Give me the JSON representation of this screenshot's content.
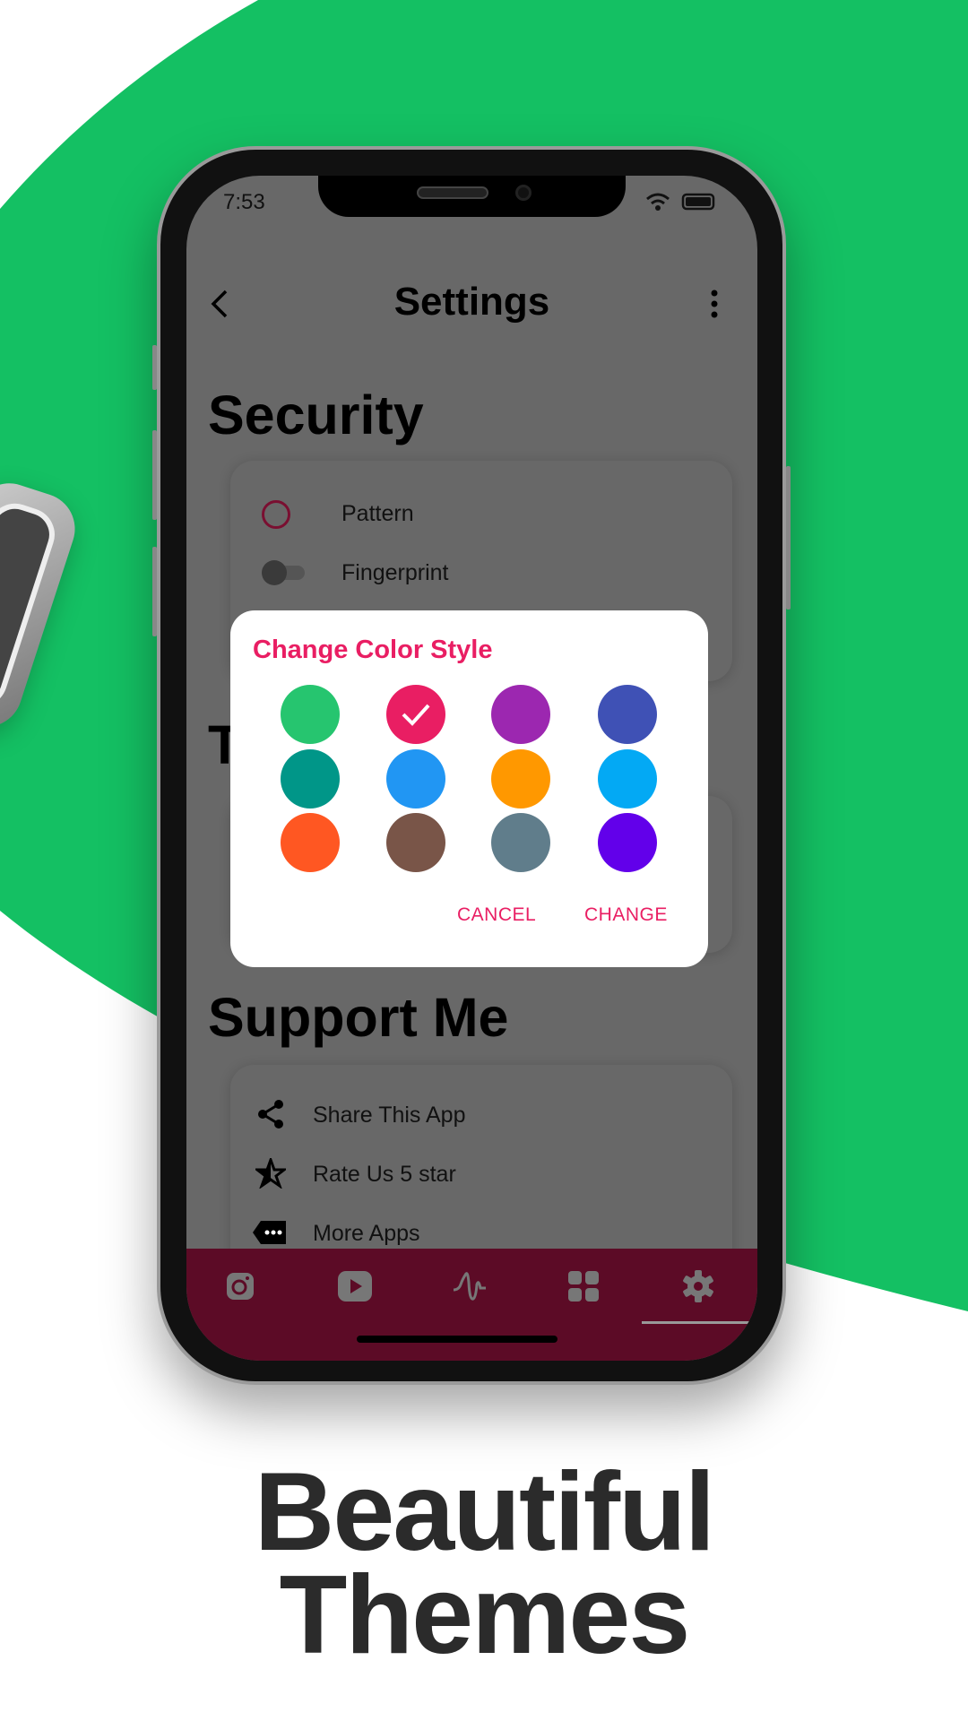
{
  "status_bar": {
    "time": "7:53"
  },
  "app_bar": {
    "title": "Settings",
    "back_icon": "chevron-left-icon",
    "menu_icon": "more-vert-icon"
  },
  "sections": {
    "security": {
      "heading": "Security",
      "items": [
        {
          "label": "Pattern",
          "control": "radio",
          "checked": false
        },
        {
          "label": "Fingerprint",
          "control": "toggle",
          "on": false
        }
      ]
    },
    "theme": {
      "heading_visible": "T"
    },
    "support": {
      "heading": "Support Me",
      "items": [
        {
          "label": "Share This App",
          "icon": "share-icon"
        },
        {
          "label": "Rate Us 5 star",
          "icon": "star-icon"
        },
        {
          "label": "More Apps",
          "icon": "more-apps-tag-icon"
        }
      ]
    }
  },
  "dialog": {
    "title": "Change Color Style",
    "selected_index": 1,
    "colors": [
      "#26c56f",
      "#e91e63",
      "#9c27b0",
      "#3f51b5",
      "#009688",
      "#2196f3",
      "#ff9800",
      "#03a9f4",
      "#ff5722",
      "#795548",
      "#607d8b",
      "#6200ea"
    ],
    "cancel_label": "CANCEL",
    "change_label": "CHANGE"
  },
  "bottom_nav": {
    "items": [
      "instagram-icon",
      "youtube-icon",
      "audio-wave-icon",
      "grid-icon",
      "settings-icon"
    ],
    "active_index": 4,
    "background": "#5c0b26"
  },
  "promo": {
    "line1": "Beautiful",
    "line2": "Themes",
    "accent": "#14c063"
  }
}
